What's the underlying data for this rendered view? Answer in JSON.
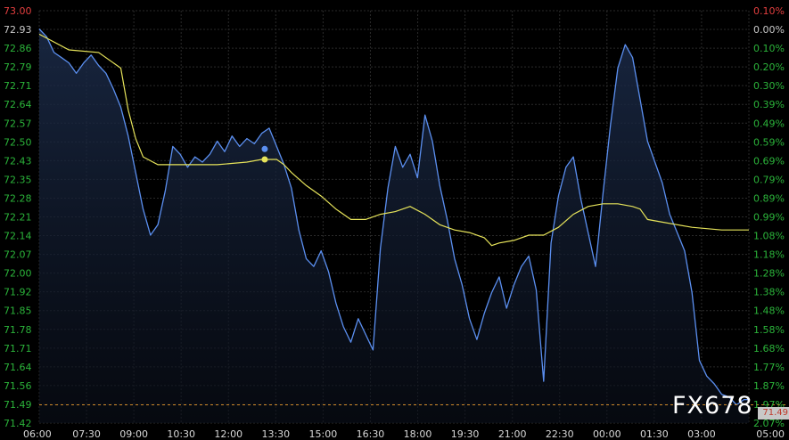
{
  "watermark": "FX678",
  "current_price_label": "71.49",
  "colors": {
    "background": "#000000",
    "grid": "#2a2a2a",
    "price_line": "#5b8ff0",
    "average_line": "#e6e35a",
    "axis_up": "#e33f3f",
    "axis_neutral": "#c8c8c8",
    "axis_down": "#2bb33a",
    "reference_line": "#d08a2a"
  },
  "chart_data": {
    "type": "line",
    "y_ticks": [
      "73.00",
      "72.93",
      "72.86",
      "72.79",
      "72.71",
      "72.64",
      "72.57",
      "72.50",
      "72.43",
      "72.35",
      "72.28",
      "72.21",
      "72.14",
      "72.07",
      "72.00",
      "71.92",
      "71.85",
      "71.78",
      "71.71",
      "71.64",
      "71.56",
      "71.49",
      "71.42"
    ],
    "pct_ticks": [
      "0.10%",
      "0.00%",
      "0.10%",
      "0.20%",
      "0.30%",
      "0.39%",
      "0.49%",
      "0.59%",
      "0.69%",
      "0.79%",
      "0.89%",
      "0.99%",
      "1.08%",
      "1.18%",
      "1.28%",
      "1.38%",
      "1.48%",
      "1.58%",
      "1.68%",
      "1.77%",
      "1.87%",
      "1.97%",
      "2.07%"
    ],
    "x_ticks": [
      "06:00",
      "07:30",
      "09:00",
      "10:30",
      "12:00",
      "13:30",
      "15:00",
      "16:30",
      "18:00",
      "19:30",
      "21:00",
      "22:30",
      "00:00",
      "01:30",
      "03:00",
      "05:00"
    ],
    "ylim": [
      71.42,
      73.0
    ],
    "reference_price": 71.49,
    "series": [
      {
        "values": [
          [
            0,
            72.93
          ],
          [
            0.25,
            72.9
          ],
          [
            0.5,
            72.84
          ],
          [
            0.75,
            72.82
          ],
          [
            1,
            72.8
          ],
          [
            1.25,
            72.76
          ],
          [
            1.5,
            72.8
          ],
          [
            1.75,
            72.83
          ],
          [
            2,
            72.79
          ],
          [
            2.25,
            72.76
          ],
          [
            2.5,
            72.7
          ],
          [
            2.75,
            72.63
          ],
          [
            3,
            72.52
          ],
          [
            3.25,
            72.38
          ],
          [
            3.5,
            72.24
          ],
          [
            3.75,
            72.14
          ],
          [
            4,
            72.18
          ],
          [
            4.25,
            72.31
          ],
          [
            4.5,
            72.48
          ],
          [
            4.75,
            72.45
          ],
          [
            5,
            72.4
          ],
          [
            5.25,
            72.44
          ],
          [
            5.5,
            72.42
          ],
          [
            5.75,
            72.45
          ],
          [
            6,
            72.5
          ],
          [
            6.25,
            72.46
          ],
          [
            6.5,
            72.52
          ],
          [
            6.75,
            72.48
          ],
          [
            7,
            72.51
          ],
          [
            7.25,
            72.49
          ],
          [
            7.5,
            72.53
          ],
          [
            7.75,
            72.55
          ],
          [
            8,
            72.48
          ],
          [
            8.25,
            72.41
          ],
          [
            8.5,
            72.32
          ],
          [
            8.75,
            72.16
          ],
          [
            9,
            72.05
          ],
          [
            9.25,
            72.02
          ],
          [
            9.5,
            72.08
          ],
          [
            9.75,
            72.0
          ],
          [
            10,
            71.88
          ],
          [
            10.25,
            71.79
          ],
          [
            10.5,
            71.73
          ],
          [
            10.75,
            71.82
          ],
          [
            11,
            71.76
          ],
          [
            11.25,
            71.7
          ],
          [
            11.5,
            72.09
          ],
          [
            11.75,
            72.32
          ],
          [
            12,
            72.48
          ],
          [
            12.25,
            72.4
          ],
          [
            12.5,
            72.45
          ],
          [
            12.75,
            72.36
          ],
          [
            13,
            72.6
          ],
          [
            13.25,
            72.5
          ],
          [
            13.5,
            72.33
          ],
          [
            13.75,
            72.2
          ],
          [
            14,
            72.05
          ],
          [
            14.25,
            71.95
          ],
          [
            14.5,
            71.82
          ],
          [
            14.75,
            71.74
          ],
          [
            15,
            71.84
          ],
          [
            15.25,
            71.92
          ],
          [
            15.5,
            71.98
          ],
          [
            15.75,
            71.86
          ],
          [
            16,
            71.95
          ],
          [
            16.25,
            72.02
          ],
          [
            16.5,
            72.06
          ],
          [
            16.75,
            71.93
          ],
          [
            17,
            71.58
          ],
          [
            17.25,
            72.11
          ],
          [
            17.5,
            72.29
          ],
          [
            17.75,
            72.4
          ],
          [
            18,
            72.44
          ],
          [
            18.25,
            72.28
          ],
          [
            18.5,
            72.15
          ],
          [
            18.75,
            72.02
          ],
          [
            19,
            72.3
          ],
          [
            19.25,
            72.56
          ],
          [
            19.5,
            72.78
          ],
          [
            19.75,
            72.87
          ],
          [
            20,
            72.82
          ],
          [
            20.25,
            72.66
          ],
          [
            20.5,
            72.5
          ],
          [
            20.75,
            72.42
          ],
          [
            21,
            72.34
          ],
          [
            21.25,
            72.22
          ],
          [
            21.5,
            72.15
          ],
          [
            21.75,
            72.08
          ],
          [
            22,
            71.92
          ],
          [
            22.25,
            71.66
          ],
          [
            22.5,
            71.6
          ],
          [
            22.75,
            71.57
          ],
          [
            23,
            71.53
          ],
          [
            23.25,
            71.52
          ],
          [
            23.5,
            71.49
          ],
          [
            23.75,
            71.51
          ],
          [
            23.917,
            71.51
          ]
        ]
      },
      {
        "values": [
          [
            0,
            72.91
          ],
          [
            1,
            72.85
          ],
          [
            2,
            72.84
          ],
          [
            2.75,
            72.78
          ],
          [
            3,
            72.62
          ],
          [
            3.25,
            72.51
          ],
          [
            3.5,
            72.44
          ],
          [
            4,
            72.41
          ],
          [
            5,
            72.41
          ],
          [
            6,
            72.41
          ],
          [
            7,
            72.42
          ],
          [
            7.5,
            72.43
          ],
          [
            8,
            72.43
          ],
          [
            8.25,
            72.41
          ],
          [
            8.5,
            72.38
          ],
          [
            9,
            72.33
          ],
          [
            9.5,
            72.29
          ],
          [
            10,
            72.24
          ],
          [
            10.5,
            72.2
          ],
          [
            11,
            72.2
          ],
          [
            11.5,
            72.22
          ],
          [
            12,
            72.23
          ],
          [
            12.5,
            72.25
          ],
          [
            13,
            72.22
          ],
          [
            13.5,
            72.18
          ],
          [
            14,
            72.16
          ],
          [
            14.5,
            72.15
          ],
          [
            15,
            72.13
          ],
          [
            15.25,
            72.1
          ],
          [
            15.5,
            72.11
          ],
          [
            16,
            72.12
          ],
          [
            16.5,
            72.14
          ],
          [
            17,
            72.14
          ],
          [
            17.5,
            72.17
          ],
          [
            18,
            72.22
          ],
          [
            18.5,
            72.25
          ],
          [
            19,
            72.26
          ],
          [
            19.5,
            72.26
          ],
          [
            20,
            72.25
          ],
          [
            20.25,
            72.24
          ],
          [
            20.5,
            72.2
          ],
          [
            21,
            72.19
          ],
          [
            21.5,
            72.18
          ],
          [
            22,
            72.17
          ],
          [
            23,
            72.16
          ],
          [
            23.917,
            72.16
          ]
        ]
      }
    ],
    "markers": [
      {
        "series": 0,
        "x": 7.6,
        "y": 72.47
      },
      {
        "series": 1,
        "x": 7.6,
        "y": 72.43
      }
    ]
  }
}
